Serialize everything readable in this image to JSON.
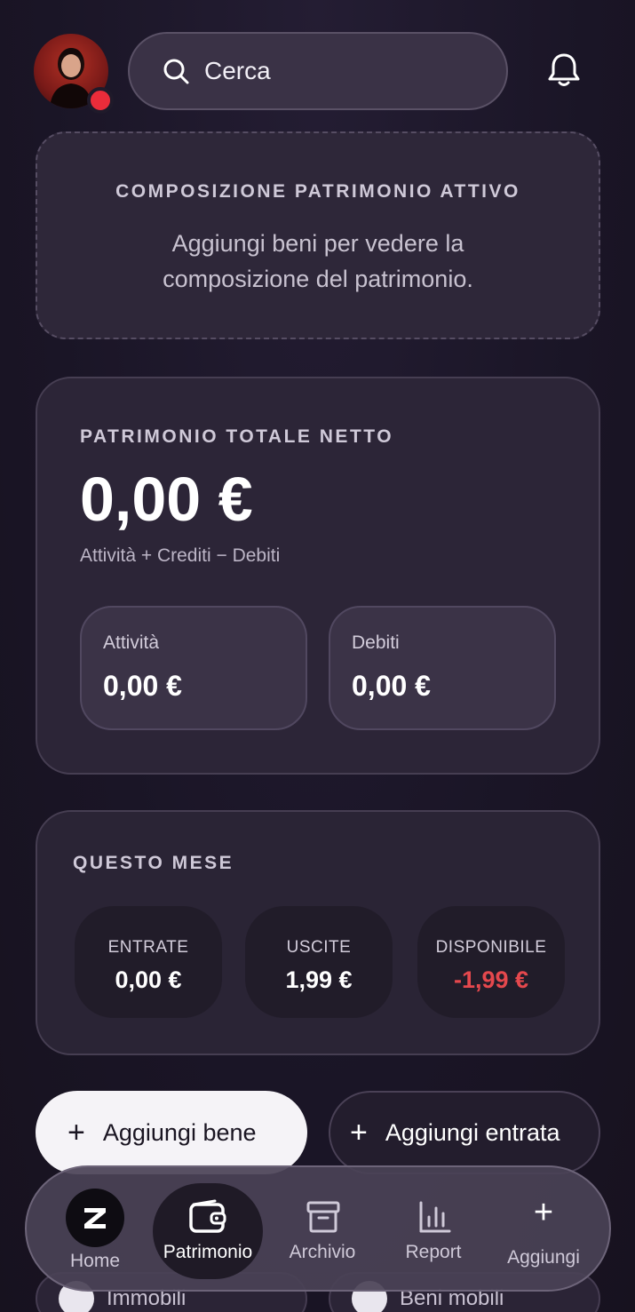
{
  "header": {
    "search_placeholder": "Cerca"
  },
  "composition": {
    "title": "COMPOSIZIONE PATRIMONIO ATTIVO",
    "empty_text": "Aggiungi beni per vedere la composizione del patrimonio."
  },
  "net_worth": {
    "title": "PATRIMONIO TOTALE NETTO",
    "value": "0,00 €",
    "formula": "Attività + Crediti − Debiti",
    "assets_label": "Attività",
    "assets_value": "0,00 €",
    "debts_label": "Debiti",
    "debts_value": "0,00 €"
  },
  "this_month": {
    "title": "QUESTO MESE",
    "income_label": "ENTRATE",
    "income_value": "0,00 €",
    "expenses_label": "USCITE",
    "expenses_value": "1,99 €",
    "available_label": "DISPONIBILE",
    "available_value": "-1,99 €"
  },
  "actions": {
    "add_asset": "Aggiungi bene",
    "add_income": "Aggiungi entrata"
  },
  "peek_row": {
    "real_estate": "Immobili",
    "movable_goods": "Beni mobili"
  },
  "nav": {
    "home": "Home",
    "patrimonio": "Patrimonio",
    "archivio": "Archivio",
    "report": "Report",
    "aggiungi": "Aggiungi"
  },
  "colors": {
    "background": "#1b1627",
    "card": "#2c2537",
    "negative": "#e5484d",
    "status_dot": "#ea2c3a"
  }
}
